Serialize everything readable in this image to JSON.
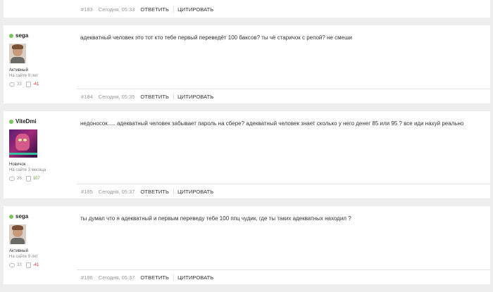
{
  "labels": {
    "reply": "ОТВЕТИТЬ",
    "quote": "ЦИТИРОВАТЬ"
  },
  "top_footer": {
    "num": "#183",
    "time": "Сегодня, 05:33"
  },
  "posts": [
    {
      "user": "sega",
      "status": "Активный",
      "since": "На сайте 9 лет",
      "comments": "33",
      "rating": "-41",
      "text": "адекватный человек это тот кто тебе первый переведёт 100 баксов? ты чё старичок с репой? не смеши",
      "num": "#184",
      "time": "Сегодня, 05:35"
    },
    {
      "user": "ViteDmi",
      "status": "Новичок",
      "since": "На сайте 3 месяца",
      "comments": "26",
      "rating": "107",
      "text": "недоносок..... адекватный человек забывает пароль на сбере? адекватный человек знает сколько у него денег 85 или 95 ?    все иди нахуй реально",
      "num": "#185",
      "time": "Сегодня, 05:37"
    },
    {
      "user": "sega",
      "status": "Активный",
      "since": "На сайте 9 лет",
      "comments": "33",
      "rating": "-41",
      "text": "ты думал что я адекватный и первым переведу тебе 100 ппц чудик, где ты таких адекватных находил ?",
      "num": "#186",
      "time": "Сегодня, 05:37"
    }
  ]
}
